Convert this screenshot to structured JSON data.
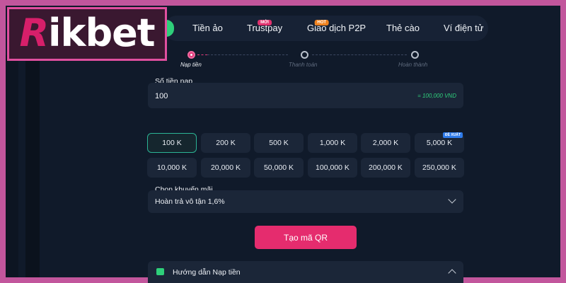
{
  "brand": {
    "logo_text_r": "R",
    "logo_text_rest": "ikbet"
  },
  "nav": {
    "items": [
      {
        "label": "Tiền ảo",
        "badge": ""
      },
      {
        "label": "Trustpay",
        "badge": "MỚI"
      },
      {
        "label": "Giao dịch P2P",
        "badge": "HOT"
      },
      {
        "label": "Thẻ cào",
        "badge": ""
      },
      {
        "label": "Ví điện tử",
        "badge": ""
      }
    ]
  },
  "steps": [
    {
      "label": "Nạp tiền",
      "active": true
    },
    {
      "label": "Thanh toán",
      "active": false
    },
    {
      "label": "Hoàn thành",
      "active": false
    }
  ],
  "amount": {
    "label": "Số tiền nạp",
    "value": "100",
    "converted": "= 100,000 VND"
  },
  "chips": {
    "row1": [
      "100 K",
      "200 K",
      "500 K",
      "1,000 K",
      "2,000 K",
      "5,000 K"
    ],
    "row2": [
      "10,000 K",
      "20,000 K",
      "50,000 K",
      "100,000 K",
      "200,000 K",
      "250,000 K"
    ],
    "selected": "100 K",
    "recommended_badge": "ĐỀ XUẤT"
  },
  "promo": {
    "label": "Chọn khuyến mãi",
    "value": "Hoàn trả vô tận 1,6%"
  },
  "qr_button": "Tạo mã QR",
  "guide": {
    "label": "Hướng dẫn Nạp tiền"
  },
  "colors": {
    "accent": "#e52c6e",
    "green": "#2ecf7a",
    "background": "#101a2a",
    "frame": "#c2569c"
  }
}
